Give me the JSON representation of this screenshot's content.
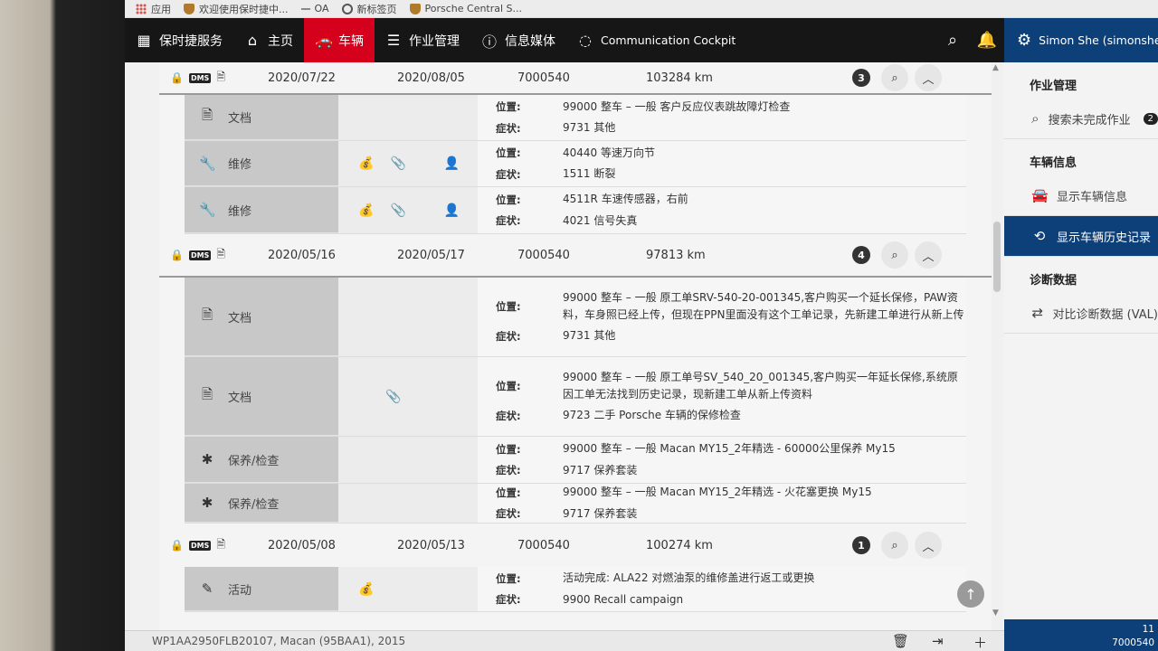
{
  "bookmarks": [
    {
      "label": "应用",
      "icon": "apps-grid-icon"
    },
    {
      "label": "欢迎使用保时捷中...",
      "icon": "porsche-crest-icon"
    },
    {
      "label": "OA",
      "icon": "dash-icon"
    },
    {
      "label": "新标签页",
      "icon": "globe-icon"
    },
    {
      "label": "Porsche Central S...",
      "icon": "porsche-crest-icon"
    }
  ],
  "nav": {
    "brand": "保时捷服务",
    "home": "主页",
    "vehicle": "车辆",
    "jobs": "作业管理",
    "media": "信息媒体",
    "cockpit": "Communication Cockpit"
  },
  "user": {
    "name": "Simon She (simonshe)"
  },
  "labels": {
    "location": "位置:",
    "symptom": "症状:"
  },
  "orders": [
    {
      "date1": "2020/07/22",
      "date2": "2020/08/05",
      "order": "7000540",
      "km": "103284 km",
      "count": "3",
      "rows": [
        {
          "type": "文档",
          "type_icon": "document-icon",
          "loc": "99000 整车 – 一般   客户反应仪表跳故障灯检查",
          "sym": "9731 其他"
        },
        {
          "type": "维修",
          "type_icon": "wrench-icon",
          "loc": "40440 等速万向节",
          "sym": "1511 断裂"
        },
        {
          "type": "维修",
          "type_icon": "wrench-icon",
          "loc": "4511R 车速传感器，右前",
          "sym": "4021 信号失真"
        }
      ]
    },
    {
      "date1": "2020/05/16",
      "date2": "2020/05/17",
      "order": "7000540",
      "km": "97813 km",
      "count": "4",
      "rows": [
        {
          "type": "文档",
          "type_icon": "document-icon",
          "loc": "99000 整车 – 一般   原工单SRV-540-20-001345,客户购买一个延长保修，PAW资料，车身照已经上传，但现在PPN里面没有这个工单记录，先新建工单进行从新上传",
          "sym": "9731 其他"
        },
        {
          "type": "文档",
          "type_icon": "document-icon",
          "loc": "99000 整车 – 一般   原工单号SV_540_20_001345,客户购买一年延长保修,系统原因工单无法找到历史记录，现新建工单从新上传资料",
          "sym": "9723 二手 Porsche 车辆的保修检查"
        },
        {
          "type": "保养/检查",
          "type_icon": "gear-icon",
          "loc": "99000 整车 – 一般   Macan MY15_2年精选 - 60000公里保养 My15",
          "sym": "9717 保养套装"
        },
        {
          "type": "保养/检查",
          "type_icon": "gear-icon",
          "loc": "99000 整车 – 一般   Macan MY15_2年精选 - 火花塞更换 My15",
          "sym": "9717 保养套装"
        }
      ]
    },
    {
      "date1": "2020/05/08",
      "date2": "2020/05/13",
      "order": "7000540",
      "km": "100274 km",
      "count": "1",
      "rows": [
        {
          "type": "活动",
          "type_icon": "campaign-icon",
          "loc": "活动完成:   ALA22 对燃油泵的维修盖进行返工或更换",
          "sym": "9900 Recall campaign"
        }
      ]
    }
  ],
  "sidebar": {
    "sec_jobs": "作业管理",
    "search_jobs": "搜索未完成作业",
    "search_jobs_count": "2",
    "sec_vehicle": "车辆信息",
    "show_vehicle": "显示车辆信息",
    "show_history": "显示车辆历史记录",
    "sec_diag": "诊断数据",
    "compare_diag": "对比诊断数据 (VAL)"
  },
  "sidebar_bottom": {
    "line1": "11",
    "line2": "7000540"
  },
  "vehicle_info": "WP1AA2950FLB20107, Macan (95BAA1), 2015",
  "colors": {
    "nav_bg": "#161616",
    "active_red": "#d5001c",
    "brand_blue": "#0d3f78"
  }
}
